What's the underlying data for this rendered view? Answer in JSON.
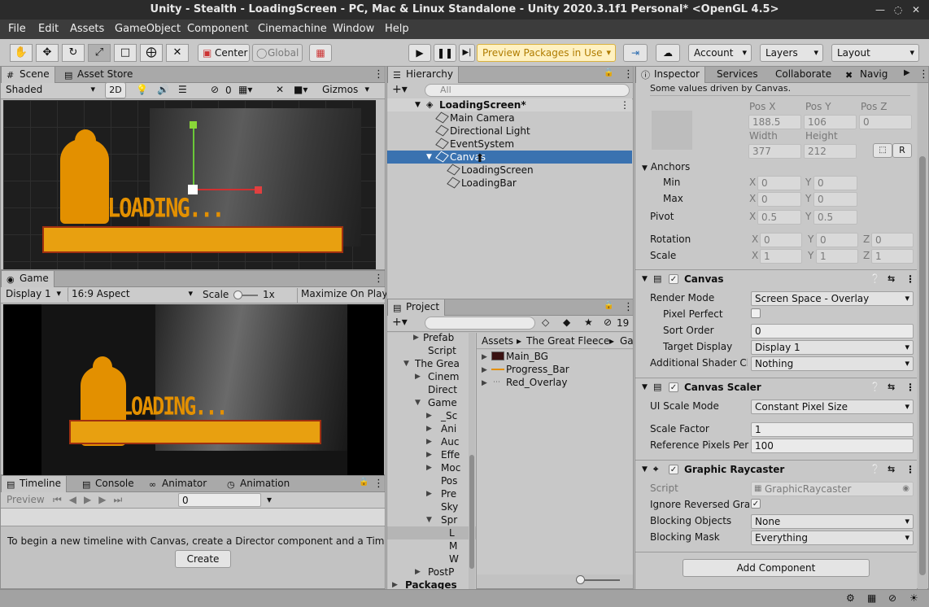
{
  "window": {
    "title": "Unity - Stealth - LoadingScreen - PC, Mac & Linux Standalone - Unity 2020.3.1f1 Personal* <OpenGL 4.5>"
  },
  "menu": [
    "File",
    "Edit",
    "Assets",
    "GameObject",
    "Component",
    "Cinemachine",
    "Window",
    "Help"
  ],
  "toolbar": {
    "center": "Center",
    "global": "Global",
    "preview_packages": "Preview Packages in Use",
    "account": "Account",
    "layers": "Layers",
    "layout": "Layout"
  },
  "scene": {
    "tab": "Scene",
    "asset_store_tab": "Asset Store",
    "shading": "Shaded",
    "mode_2d": "2D",
    "hidden_count": "0",
    "gizmos": "Gizmos",
    "loading_text": "LOADING...",
    "search_placeholder": "All"
  },
  "game": {
    "tab": "Game",
    "display": "Display 1",
    "aspect": "16:9 Aspect",
    "scale_label": "Scale",
    "scale_value": "1x",
    "maximize": "Maximize On Play",
    "loading_text": "LOADING..."
  },
  "timeline": {
    "tabs": [
      "Timeline",
      "Console",
      "Animator",
      "Animation"
    ],
    "preview": "Preview",
    "frame": "0",
    "message": "To begin a new timeline with Canvas, create a Director component and a Timeline a",
    "create": "Create"
  },
  "hierarchy": {
    "tab": "Hierarchy",
    "search_placeholder": "All",
    "scene_name": "LoadingScreen*",
    "items": [
      "Main Camera",
      "Directional Light",
      "EventSystem",
      "Canvas",
      "LoadingScreen",
      "LoadingBar"
    ]
  },
  "project": {
    "tab": "Project",
    "hidden_count": "19",
    "breadcrumb": [
      "Assets",
      "The Great Fleece",
      "Ga"
    ],
    "tree": [
      "Prefab",
      "Script",
      "The Grea",
      "Cinem",
      "Direct",
      "Game",
      "_Sc",
      "Ani",
      "Auc",
      "Effe",
      "Moc",
      "Pos",
      "Pre",
      "Sky",
      "Spr",
      "L",
      "M",
      "W",
      "PostP",
      "Packages"
    ],
    "assets": [
      "Main_BG",
      "Progress_Bar",
      "Red_Overlay"
    ]
  },
  "inspector": {
    "tabs": [
      "Inspector",
      "Services",
      "Collaborate",
      "Navig"
    ],
    "driven_note": "Some values driven by Canvas.",
    "rect": {
      "pos_x_label": "Pos X",
      "pos_y_label": "Pos Y",
      "pos_z_label": "Pos Z",
      "pos_x": "188.5",
      "pos_y": "106",
      "pos_z": "0",
      "width_label": "Width",
      "height_label": "Height",
      "width": "377",
      "height": "212",
      "r_button": "R"
    },
    "anchors": {
      "label": "Anchors",
      "min_label": "Min",
      "max_label": "Max",
      "min_x": "0",
      "min_y": "0",
      "max_x": "0",
      "max_y": "0"
    },
    "pivot": {
      "label": "Pivot",
      "x": "0.5",
      "y": "0.5"
    },
    "rotation": {
      "label": "Rotation",
      "x": "0",
      "y": "0",
      "z": "0"
    },
    "scale": {
      "label": "Scale",
      "x": "1",
      "y": "1",
      "z": "1"
    },
    "axis": {
      "x": "X",
      "y": "Y",
      "z": "Z"
    },
    "canvas": {
      "title": "Canvas",
      "render_mode_label": "Render Mode",
      "render_mode": "Screen Space - Overlay",
      "pixel_perfect_label": "Pixel Perfect",
      "sort_order_label": "Sort Order",
      "sort_order": "0",
      "target_display_label": "Target Display",
      "target_display": "Display 1",
      "shader_label": "Additional Shader Cha",
      "shader": "Nothing"
    },
    "scaler": {
      "title": "Canvas Scaler",
      "ui_scale_mode_label": "UI Scale Mode",
      "ui_scale_mode": "Constant Pixel Size",
      "scale_factor_label": "Scale Factor",
      "scale_factor": "1",
      "ref_ppu_label": "Reference Pixels Per U",
      "ref_ppu": "100"
    },
    "raycaster": {
      "title": "Graphic Raycaster",
      "script_label": "Script",
      "script": "GraphicRaycaster",
      "ignore_reversed_label": "Ignore Reversed Grap",
      "blocking_objects_label": "Blocking Objects",
      "blocking_objects": "None",
      "blocking_mask_label": "Blocking Mask",
      "blocking_mask": "Everything"
    },
    "add_component": "Add Component"
  }
}
